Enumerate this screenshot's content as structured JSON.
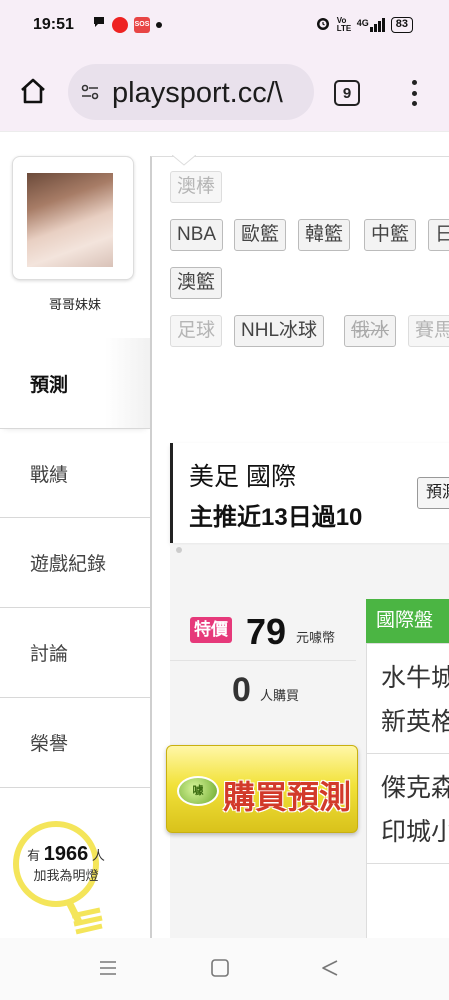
{
  "status_bar": {
    "time": "19:51",
    "network": "4G",
    "volte": "Vo LTE",
    "battery": "83"
  },
  "browser": {
    "url": "playsport.cc/\\",
    "tab_count": "9"
  },
  "sidebar": {
    "username": "哥哥妹妹",
    "items": [
      {
        "label": "預測",
        "active": true
      },
      {
        "label": "戰績",
        "active": false
      },
      {
        "label": "遊戲紀錄",
        "active": false
      },
      {
        "label": "討論",
        "active": false
      },
      {
        "label": "榮譽",
        "active": false
      }
    ],
    "lamp": {
      "prefix": "有",
      "count": "1966",
      "suffix": "人",
      "caption": "加我為明燈"
    }
  },
  "categories": [
    {
      "label": "澳棒",
      "style": "faded"
    },
    {
      "label": "NBA",
      "style": "normal"
    },
    {
      "label": "歐籃",
      "style": "normal"
    },
    {
      "label": "韓籃",
      "style": "normal"
    },
    {
      "label": "中籃",
      "style": "normal"
    },
    {
      "label": "日",
      "style": "normal"
    },
    {
      "label": "澳籃",
      "style": "normal"
    },
    {
      "label": "足球",
      "style": "faded"
    },
    {
      "label": "NHL冰球",
      "style": "normal"
    },
    {
      "label": "俄冰",
      "style": "strike"
    },
    {
      "label": "賽馬",
      "style": "faded"
    }
  ],
  "game": {
    "league": "美足 國際",
    "summary": "主推近13日過10",
    "predict_button": "預測"
  },
  "offer": {
    "badge": "特價",
    "price": "79",
    "price_unit": "元噱幣",
    "buyers": "0",
    "buyers_unit": "人購買",
    "buy_button": "購買預測",
    "coin_label": "噱"
  },
  "market": {
    "tab_label": "國際盤",
    "matches": [
      {
        "home": "水牛城",
        "away": "新英格"
      },
      {
        "home": "傑克森",
        "away": "印城小"
      }
    ]
  },
  "colors": {
    "special_badge": "#e6397a",
    "market_tab": "#4bb543",
    "buy_button": "#f2e23a",
    "lamp": "#f4e55a"
  }
}
